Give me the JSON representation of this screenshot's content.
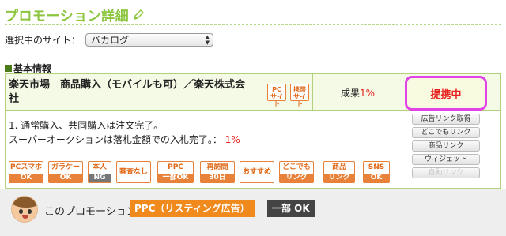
{
  "header": {
    "title": "プロモーション詳細"
  },
  "site": {
    "label": "選択中のサイト：",
    "selected": "バカログ"
  },
  "section": {
    "title": "基本情報"
  },
  "program": {
    "name": "楽天市場　商品購入（モバイルも可）／楽天株式会社",
    "badges": [
      {
        "top": "PC",
        "bottom": "サイト"
      },
      {
        "top": "携帯",
        "bottom": "サイト"
      }
    ],
    "reward_label": "成果",
    "reward_value": "1%",
    "status": "提携中"
  },
  "conditions": {
    "line1": "1. 通常購入、共同購入は注文完了。",
    "line2": "スーパーオークションは落札金額での入札完了。：",
    "line2_value": "1%"
  },
  "side_buttons": [
    "広告リンク取得",
    "どこでもリンク",
    "商品リンク",
    "ウィジェット",
    "自動リンク"
  ],
  "features": [
    {
      "top": "PCスマホ",
      "bottom": "OK"
    },
    {
      "top": "ガラケー",
      "bottom": "OK"
    },
    {
      "top": "本人",
      "bottom": "NG"
    },
    {
      "top": "審査なし"
    },
    {
      "top": "PPC",
      "bottom": "一部OK"
    },
    {
      "top": "再訪問",
      "bottom": "30日"
    },
    {
      "top": "おすすめ"
    },
    {
      "top": "どこでも",
      "bottom": "リンク"
    },
    {
      "top": "商品",
      "bottom": "リンク"
    },
    {
      "top": "SNS",
      "bottom": "OK"
    }
  ],
  "notice": {
    "text": "このプロモーションは",
    "ppc_label": "PPC（リスティング広告）",
    "ok_label": "一部 OK"
  },
  "colors": {
    "accent": "#8cc63f",
    "badge_orange": "#e8823a",
    "status_red": "#e8231f",
    "highlight_magenta": "#e044e6"
  }
}
